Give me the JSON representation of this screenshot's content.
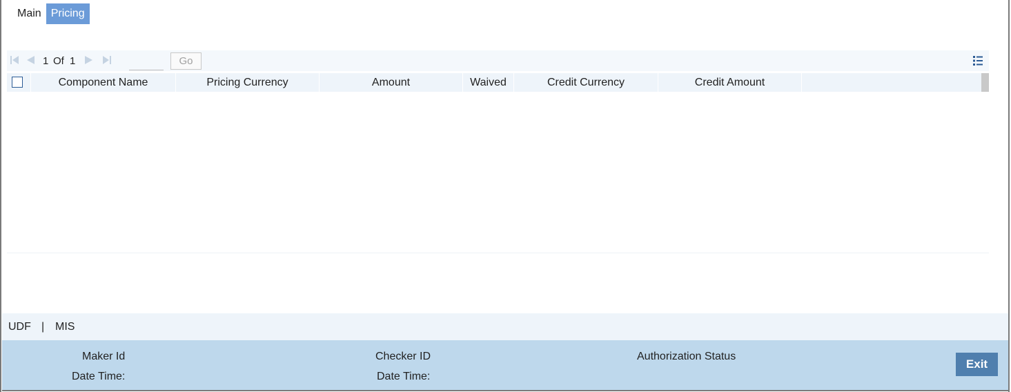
{
  "tabs": [
    {
      "label": "Main",
      "active": false
    },
    {
      "label": "Pricing",
      "active": true
    }
  ],
  "pager": {
    "current_page": "1",
    "of_label": "Of",
    "total_pages": "1",
    "page_input_value": "",
    "go_label": "Go"
  },
  "grid": {
    "columns": [
      "Component Name",
      "Pricing Currency",
      "Amount",
      "Waived",
      "Credit Currency",
      "Credit Amount"
    ],
    "rows": []
  },
  "bottom_links": {
    "udf": "UDF",
    "separator": "|",
    "mis": "MIS"
  },
  "footer": {
    "maker_id_label": "Maker Id",
    "maker_datetime_label": "Date Time:",
    "checker_id_label": "Checker ID",
    "checker_datetime_label": "Date Time:",
    "authorization_status_label": "Authorization Status",
    "exit_label": "Exit"
  },
  "colors": {
    "active_tab": "#6b9bd8",
    "header_bg": "#eef4fa",
    "footer_bg": "#bed8ec",
    "exit_button": "#4f7fae"
  },
  "icons": [
    "first-page-icon",
    "previous-page-icon",
    "next-page-icon",
    "last-page-icon",
    "column-settings-icon"
  ]
}
